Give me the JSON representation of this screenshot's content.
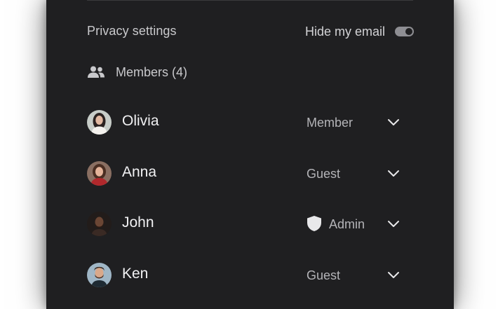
{
  "privacy": {
    "label": "Privacy settings",
    "hide_email_label": "Hide my email",
    "hide_email_on": true
  },
  "members": {
    "label": "Members (4)",
    "icon": "users-icon",
    "list": [
      {
        "name": "Olivia",
        "role": "Member",
        "role_icon": null
      },
      {
        "name": "Anna",
        "role": "Guest",
        "role_icon": null
      },
      {
        "name": "John",
        "role": "Admin",
        "role_icon": "shield-icon"
      },
      {
        "name": "Ken",
        "role": "Guest",
        "role_icon": null
      }
    ]
  },
  "colors": {
    "panel_bg": "#1f1f21",
    "text_primary": "#f1f1f3",
    "text_secondary": "#b4b4b8",
    "toggle_on": "#8e8e93"
  }
}
